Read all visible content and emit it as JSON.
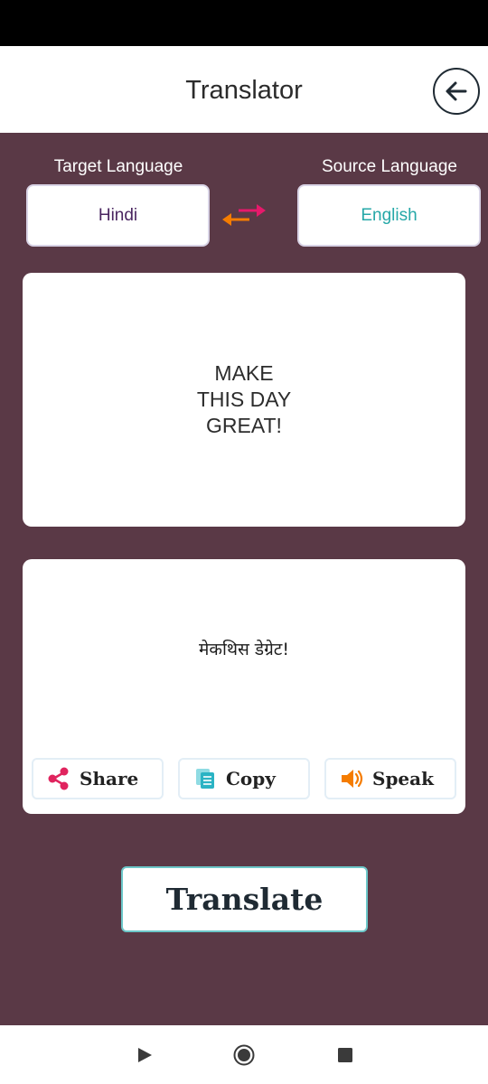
{
  "header": {
    "title": "Translator",
    "back_icon": "arrow-left-circle-icon"
  },
  "languages": {
    "target_label": "Target Language",
    "source_label": "Source Language",
    "target_value": "Hindi",
    "source_value": "English",
    "swap_icon": "swap-arrows-icon"
  },
  "input": {
    "text": "MAKE THIS DAY GREAT!"
  },
  "output": {
    "text": "मेकथिस डेग्रेट!"
  },
  "actions": {
    "share_label": "Share",
    "copy_label": "Copy",
    "speak_label": "Speak"
  },
  "translate_label": "Translate",
  "colors": {
    "background": "#5a3946",
    "share_accent": "#e0245e",
    "copy_accent": "#2ab3c4",
    "speak_accent": "#f57c00",
    "target_text": "#4a2560",
    "source_text": "#26a8a8"
  },
  "navigation": {
    "back": "triangle-back-icon",
    "home": "circle-home-icon",
    "recents": "square-recents-icon"
  }
}
